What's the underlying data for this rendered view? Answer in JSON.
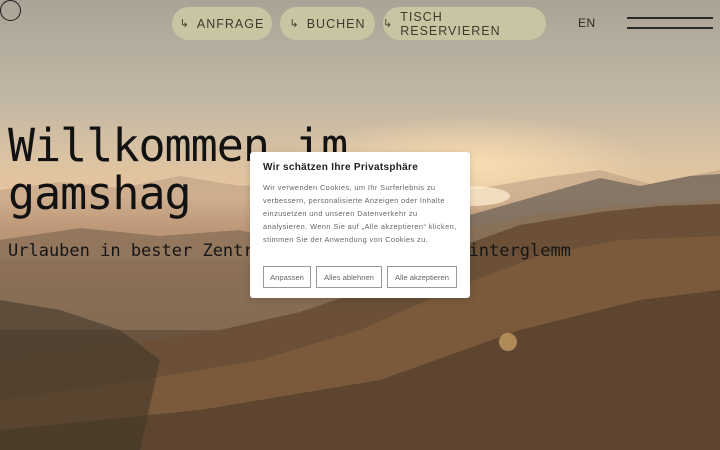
{
  "nav": {
    "arrow_glyph": "↳",
    "anfrage": "ANFRAGE",
    "buchen": "BUCHEN",
    "tisch": "TISCH RESERVIEREN",
    "language": "EN"
  },
  "hero": {
    "title_line1": "Willkommen im",
    "title_line2": "gamshag",
    "subtitle": "Urlauben in bester Zentrumslage in Saalbach-Hinterglemm"
  },
  "cookie_banner": {
    "title": "Wir schätzen Ihre Privatsphäre",
    "text": "Wir verwenden Cookies, um Ihr Surferlebnis zu verbessern, personalisierte Anzeigen oder Inhalte einzusetzen und unseren Datenverkehr zu analysieren. Wenn Sie auf „Alle akzeptieren“ klicken, stimmen Sie der Anwendung von Cookies zu.",
    "buttons": {
      "customize": "Anpassen",
      "reject": "Alles ablehnen",
      "accept": "Alle akzeptieren"
    }
  },
  "colors": {
    "pill_bg": "#c9c4a2",
    "pill_text": "#3d3a2e",
    "headline": "#121212"
  }
}
